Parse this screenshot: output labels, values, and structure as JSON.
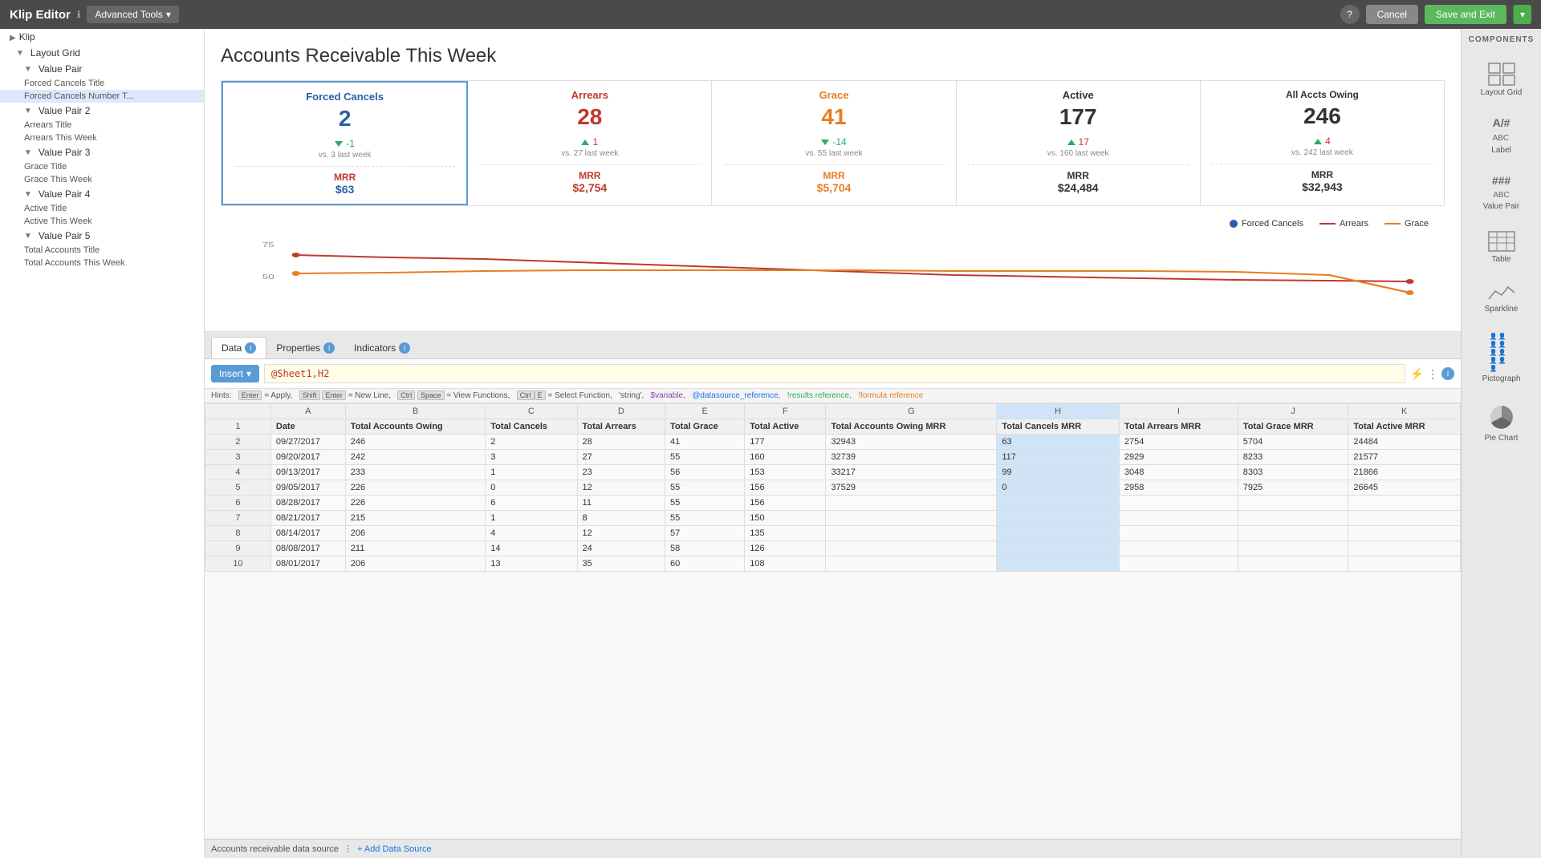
{
  "topBar": {
    "title": "Klip Editor",
    "advancedTools": "Advanced Tools",
    "cancelLabel": "Cancel",
    "saveLabel": "Save and Exit"
  },
  "leftPanel": {
    "items": [
      {
        "label": "Klip",
        "level": 0,
        "type": "root"
      },
      {
        "label": "Layout Grid",
        "level": 1,
        "type": "section"
      },
      {
        "label": "Value Pair",
        "level": 2,
        "type": "section"
      },
      {
        "label": "Forced Cancels Title",
        "level": 3,
        "type": "child"
      },
      {
        "label": "Forced Cancels Number T...",
        "level": 3,
        "type": "child",
        "active": true
      },
      {
        "label": "Value Pair 2",
        "level": 2,
        "type": "section"
      },
      {
        "label": "Arrears Title",
        "level": 3,
        "type": "child"
      },
      {
        "label": "Arrears This Week",
        "level": 3,
        "type": "child"
      },
      {
        "label": "Value Pair 3",
        "level": 2,
        "type": "section"
      },
      {
        "label": "Grace Title",
        "level": 3,
        "type": "child"
      },
      {
        "label": "Grace This Week",
        "level": 3,
        "type": "child"
      },
      {
        "label": "Value Pair 4",
        "level": 2,
        "type": "section"
      },
      {
        "label": "Active Title",
        "level": 3,
        "type": "child"
      },
      {
        "label": "Active This Week",
        "level": 3,
        "type": "child"
      },
      {
        "label": "Value Pair 5",
        "level": 2,
        "type": "section"
      },
      {
        "label": "Total Accounts Title",
        "level": 3,
        "type": "child"
      },
      {
        "label": "Total Accounts This Week",
        "level": 3,
        "type": "child"
      }
    ]
  },
  "preview": {
    "title": "Accounts Receivable This Week",
    "cards": [
      {
        "title": "Forced Cancels",
        "titleColor": "blue",
        "number": "2",
        "numberColor": "blue",
        "changeValue": "-1",
        "changeType": "down-green",
        "vsText": "vs. 3 last week",
        "mrrLabel": "MRR",
        "mrrLabelColor": "red",
        "mrrValue": "$63",
        "mrrValueColor": "blue"
      },
      {
        "title": "Arrears",
        "titleColor": "red",
        "number": "28",
        "numberColor": "red",
        "changeValue": "1",
        "changeType": "up-red",
        "vsText": "vs. 27 last week",
        "mrrLabel": "MRR",
        "mrrLabelColor": "red",
        "mrrValue": "$2,754",
        "mrrValueColor": "red"
      },
      {
        "title": "Grace",
        "titleColor": "orange",
        "number": "41",
        "numberColor": "orange",
        "changeValue": "-14",
        "changeType": "down-green",
        "vsText": "vs. 55 last week",
        "mrrLabel": "MRR",
        "mrrLabelColor": "orange",
        "mrrValue": "$5,704",
        "mrrValueColor": "orange"
      },
      {
        "title": "Active",
        "titleColor": "black",
        "number": "177",
        "numberColor": "black",
        "changeValue": "17",
        "changeType": "up-red",
        "vsText": "vs. 160 last week",
        "mrrLabel": "MRR",
        "mrrLabelColor": "black",
        "mrrValue": "$24,484",
        "mrrValueColor": "black"
      },
      {
        "title": "All Accts Owing",
        "titleColor": "black",
        "number": "246",
        "numberColor": "black",
        "changeValue": "4",
        "changeType": "up-red",
        "vsText": "vs. 242 last week",
        "mrrLabel": "MRR",
        "mrrLabelColor": "black",
        "mrrValue": "$32,943",
        "mrrValueColor": "black"
      }
    ],
    "chart": {
      "legend": [
        {
          "label": "Forced Cancels",
          "color": "#2b5ea7",
          "type": "dot"
        },
        {
          "label": "Arrears",
          "color": "#c0392b",
          "type": "line"
        },
        {
          "label": "Grace",
          "color": "#e67e22",
          "type": "line"
        }
      ]
    }
  },
  "tabs": [
    {
      "label": "Data",
      "active": true
    },
    {
      "label": "Properties",
      "active": false
    },
    {
      "label": "Indicators",
      "active": false
    }
  ],
  "formulaBar": {
    "insertLabel": "Insert",
    "formula": "@Sheet1,H2"
  },
  "hints": "Hints:  Enter = Apply,  Shift Enter = New Line,  Ctrl Space = View Functions,  Ctrl+E = Select Function,  'string',  $variable,  @datasource_reference,  !results reference,  !formula reference",
  "spreadsheet": {
    "columns": [
      "A",
      "B",
      "C",
      "D",
      "E",
      "F",
      "G",
      "H",
      "I",
      "J",
      "K"
    ],
    "headers": [
      "Date",
      "Total Accounts Owing",
      "Total Cancels",
      "Total Arrears",
      "Total Grace",
      "Total Active",
      "Total Accounts Owing MRR",
      "Total Cancels MRR",
      "Total Arrears MRR",
      "Total Grace MRR",
      "Total Active MRR"
    ],
    "rows": [
      [
        "09/27/2017",
        "246",
        "2",
        "28",
        "41",
        "177",
        "32943",
        "63",
        "2754",
        "5704",
        "24484"
      ],
      [
        "09/20/2017",
        "242",
        "3",
        "27",
        "55",
        "160",
        "32739",
        "117",
        "2929",
        "8233",
        "21577"
      ],
      [
        "09/13/2017",
        "233",
        "1",
        "23",
        "56",
        "153",
        "33217",
        "99",
        "3048",
        "8303",
        "21866"
      ],
      [
        "09/05/2017",
        "226",
        "0",
        "12",
        "55",
        "156",
        "37529",
        "0",
        "2958",
        "7925",
        "26645"
      ],
      [
        "08/28/2017",
        "226",
        "6",
        "11",
        "55",
        "156",
        "",
        "",
        "",
        "",
        ""
      ],
      [
        "08/21/2017",
        "215",
        "1",
        "8",
        "55",
        "150",
        "",
        "",
        "",
        "",
        ""
      ],
      [
        "08/14/2017",
        "206",
        "4",
        "12",
        "57",
        "135",
        "",
        "",
        "",
        "",
        ""
      ],
      [
        "08/08/2017",
        "211",
        "14",
        "24",
        "58",
        "126",
        "",
        "",
        "",
        "",
        ""
      ],
      [
        "08/01/2017",
        "206",
        "13",
        "35",
        "60",
        "108",
        "",
        "",
        "",
        "",
        ""
      ]
    ]
  },
  "bottomBar": {
    "datasourceLabel": "Accounts receivable data source",
    "addDatasource": "+ Add Data Source"
  },
  "rightPanel": {
    "header": "COMPONENTS",
    "items": [
      {
        "label": "Layout Grid",
        "icon": "grid"
      },
      {
        "label": "Label",
        "icon": "label"
      },
      {
        "label": "Value Pair",
        "icon": "valuepair"
      },
      {
        "label": "Table",
        "icon": "table"
      },
      {
        "label": "Sparkline",
        "icon": "sparkline"
      },
      {
        "label": "Pictograph",
        "icon": "pictograph"
      },
      {
        "label": "Pie Chart",
        "icon": "piechart"
      }
    ]
  }
}
